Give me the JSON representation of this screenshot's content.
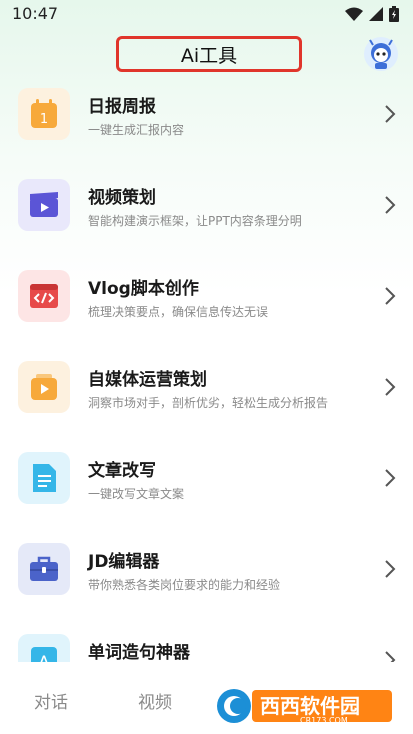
{
  "status_bar": {
    "time": "10:47"
  },
  "header": {
    "title": "Ai工具"
  },
  "tools": [
    {
      "title": "日报周报",
      "desc": "一键生成汇报内容",
      "icon": "calendar-icon",
      "color": "#f7a93b",
      "bg": "#fdf1df",
      "badge": "1"
    },
    {
      "title": "视频策划",
      "desc": "智能构建演示框架，让PPT内容条理分明",
      "icon": "clapperboard-icon",
      "color": "#5b55d6",
      "bg": "#e9e8fb"
    },
    {
      "title": "Vlog脚本创作",
      "desc": "梳理决策要点，确保信息传达无误",
      "icon": "code-window-icon",
      "color": "#e74a4a",
      "bg": "#fde5e5"
    },
    {
      "title": "自媒体运营策划",
      "desc": "洞察市场对手，剖析优劣，轻松生成分析报告",
      "icon": "media-play-icon",
      "color": "#f7a93b",
      "bg": "#fdf1df"
    },
    {
      "title": "文章改写",
      "desc": "一键改写文章文案",
      "icon": "document-icon",
      "color": "#35b6e8",
      "bg": "#e0f4fc"
    },
    {
      "title": "JD编辑器",
      "desc": "带你熟悉各类岗位要求的能力和经验",
      "icon": "briefcase-icon",
      "color": "#4b63c9",
      "bg": "#e5e9f8"
    },
    {
      "title": "单词造句神器",
      "desc": "",
      "icon": "letter-a-icon",
      "color": "#35b6e8",
      "bg": "#e0f4fc",
      "badge": "A"
    }
  ],
  "tabs": [
    {
      "label": "对话"
    },
    {
      "label": "视频"
    }
  ],
  "watermark": {
    "text": "西西软件园",
    "sub": "CR173.COM"
  }
}
